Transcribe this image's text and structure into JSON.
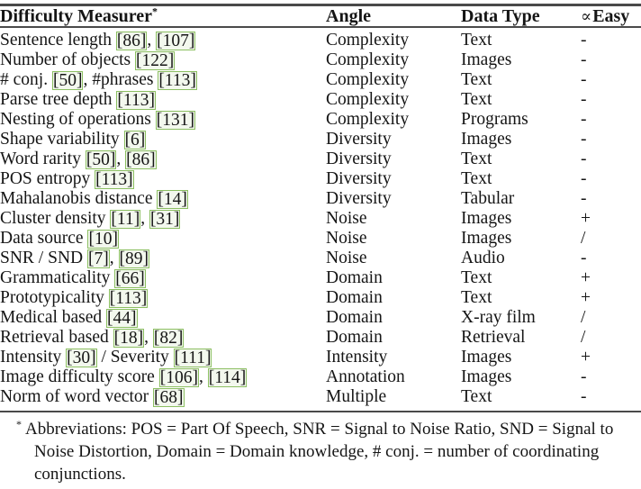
{
  "table": {
    "columns": [
      {
        "key": "measurer",
        "label": "Difficulty Measurer",
        "marker": "*"
      },
      {
        "key": "angle",
        "label": "Angle"
      },
      {
        "key": "data_type",
        "label": "Data Type"
      },
      {
        "key": "easy",
        "label": "Easy",
        "prefix_symbol": "∝"
      }
    ],
    "rows": [
      {
        "measurer_text": "Sentence length",
        "citations": [
          "[86]",
          "[107]"
        ],
        "citation_separator": ", ",
        "angle": "Complexity",
        "data_type": "Text",
        "easy": "-"
      },
      {
        "measurer_text": "Number of objects",
        "citations": [
          "[122]"
        ],
        "citation_separator": "",
        "angle": "Complexity",
        "data_type": "Images",
        "easy": "-"
      },
      {
        "measurer_text": "# conj.",
        "citations": [
          "[50]"
        ],
        "citation_separator": "",
        "measurer_text2": ", #phrases",
        "citations2": [
          "[113]"
        ],
        "angle": "Complexity",
        "data_type": "Text",
        "easy": "-"
      },
      {
        "measurer_text": "Parse tree depth",
        "citations": [
          "[113]"
        ],
        "citation_separator": "",
        "angle": "Complexity",
        "data_type": "Text",
        "easy": "-"
      },
      {
        "measurer_text": "Nesting of operations",
        "citations": [
          "[131]"
        ],
        "citation_separator": "",
        "angle": "Complexity",
        "data_type": "Programs",
        "easy": "-"
      },
      {
        "measurer_text": "Shape variability",
        "citations": [
          "[6]"
        ],
        "citation_separator": "",
        "angle": "Diversity",
        "data_type": "Images",
        "easy": "-"
      },
      {
        "measurer_text": "Word rarity",
        "citations": [
          "[50]",
          "[86]"
        ],
        "citation_separator": ", ",
        "angle": "Diversity",
        "data_type": "Text",
        "easy": "-"
      },
      {
        "measurer_text": "POS entropy",
        "citations": [
          "[113]"
        ],
        "citation_separator": "",
        "angle": "Diversity",
        "data_type": "Text",
        "easy": "-"
      },
      {
        "measurer_text": "Mahalanobis distance",
        "citations": [
          "[14]"
        ],
        "citation_separator": "",
        "angle": "Diversity",
        "data_type": "Tabular",
        "easy": "-"
      },
      {
        "measurer_text": "Cluster density",
        "citations": [
          "[11]",
          "[31]"
        ],
        "citation_separator": ", ",
        "angle": "Noise",
        "data_type": "Images",
        "easy": "+"
      },
      {
        "measurer_text": "Data source",
        "citations": [
          "[10]"
        ],
        "citation_separator": "",
        "angle": "Noise",
        "data_type": "Images",
        "easy": "/"
      },
      {
        "measurer_text": "SNR / SND ",
        "citations": [
          "[7]",
          "[89]"
        ],
        "citation_separator": ", ",
        "angle": "Noise",
        "data_type": "Audio",
        "easy": "-"
      },
      {
        "measurer_text": "Grammaticality",
        "citations": [
          "[66]"
        ],
        "citation_separator": "",
        "angle": "Domain",
        "data_type": "Text",
        "easy": "+"
      },
      {
        "measurer_text": "Prototypicality",
        "citations": [
          "[113]"
        ],
        "citation_separator": "",
        "angle": "Domain",
        "data_type": "Text",
        "easy": "+"
      },
      {
        "measurer_text": "Medical based",
        "citations": [
          "[44]"
        ],
        "citation_separator": "",
        "angle": "Domain",
        "data_type": "X-ray film",
        "easy": "/"
      },
      {
        "measurer_text": "Retrieval based",
        "citations": [
          "[18]",
          "[82]"
        ],
        "citation_separator": ", ",
        "angle": "Domain",
        "data_type": "Retrieval",
        "easy": "/"
      },
      {
        "measurer_text": "Intensity",
        "citations": [
          "[30]"
        ],
        "citation_separator": "",
        "measurer_text2": " / Severity",
        "citations2": [
          "[111]"
        ],
        "angle": "Intensity",
        "data_type": "Images",
        "easy": "+"
      },
      {
        "measurer_text": "Image difficulty score",
        "citations": [
          "[106]",
          "[114]"
        ],
        "citation_separator": ", ",
        "angle": "Annotation",
        "data_type": "Images",
        "easy": "-"
      },
      {
        "measurer_text": "Norm of word vector",
        "citations": [
          "[68]"
        ],
        "citation_separator": "",
        "angle": "Multiple",
        "data_type": "Text",
        "easy": "-"
      }
    ]
  },
  "footnote": {
    "marker": "*",
    "text": "Abbreviations: POS = Part Of Speech, SNR = Signal to Noise Ratio, SND = Signal to Noise Distortion, Domain = Domain knowledge, # conj. = number of coordinating conjunctions."
  },
  "colors": {
    "rule": "#4a4a4a",
    "text": "#151515",
    "citation_box_border": "#8cbf62",
    "background": "#ffffff"
  }
}
